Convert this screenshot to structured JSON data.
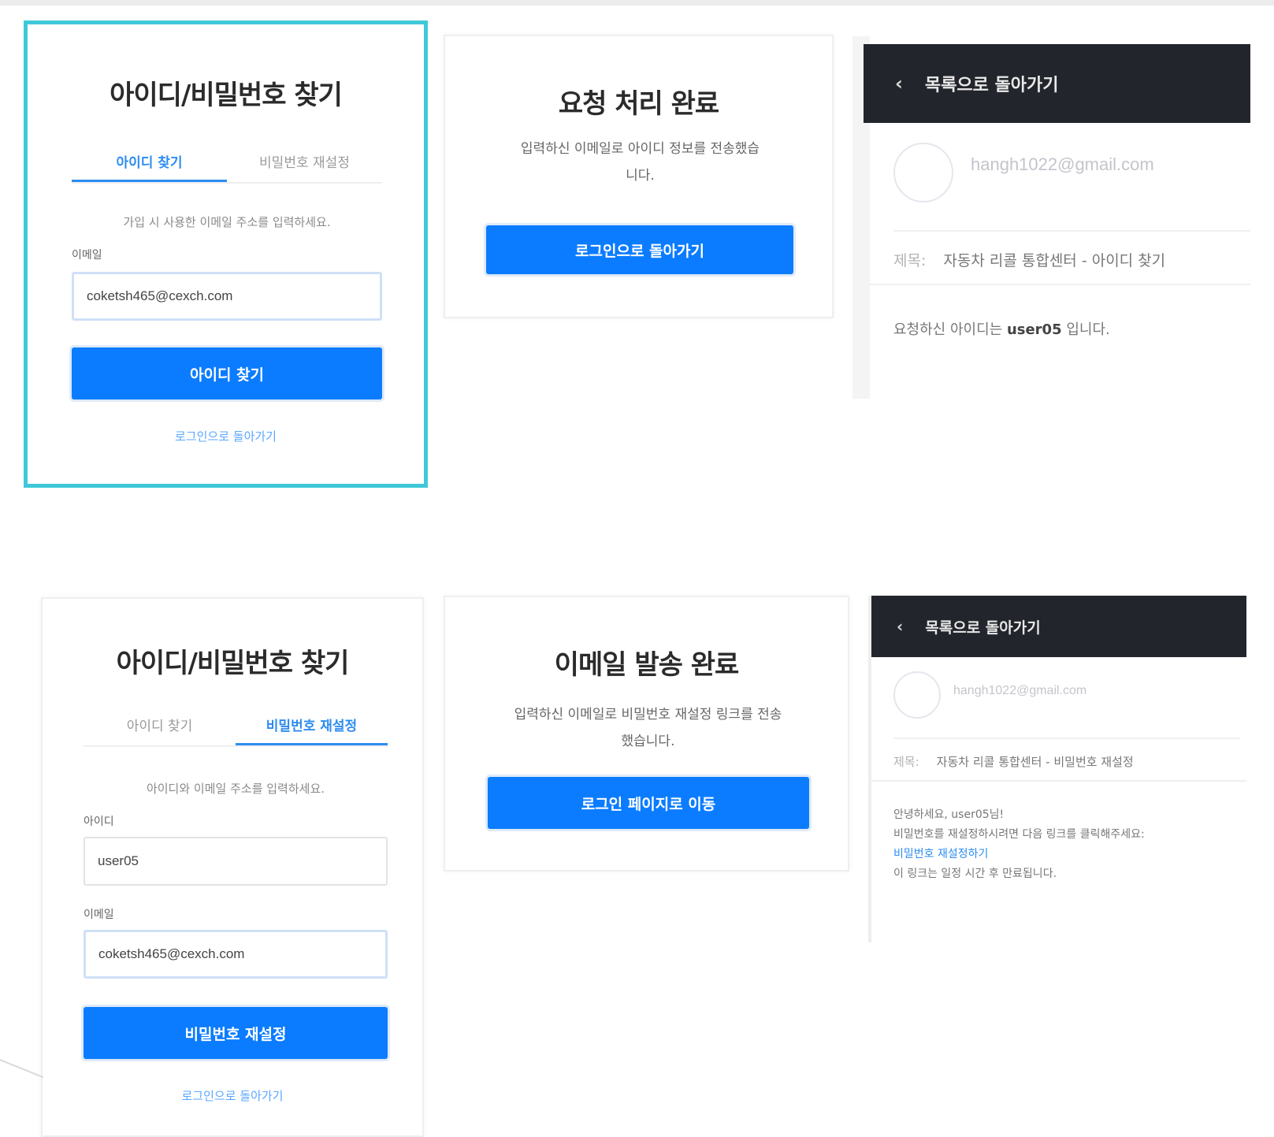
{
  "find_id": {
    "title": "아이디/비밀번호 찾기",
    "tabs": [
      "아이디 찾기",
      "비밀번호 재설정"
    ],
    "active_tab": 0,
    "description": "가입 시 사용한 이메일 주소를 입력하세요.",
    "email_label": "이메일",
    "email_value": "coketsh465@cexch.com",
    "submit_label": "아이디 찾기",
    "back_link": "로그인으로 돌아가기"
  },
  "request_done": {
    "title": "요청 처리 완료",
    "message_line1": "입력하신 이메일로 아이디 정보를 전송했습",
    "message_line2": "니다.",
    "button_label": "로그인으로 돌아가기"
  },
  "mail_id": {
    "back_label": "목록으로 돌아가기",
    "sender": "hangh1022@gmail.com",
    "subject_key": "제목:",
    "subject": "자동차 리콜 통합센터 - 아이디 찾기",
    "body_prefix": "요청하신 아이디는 ",
    "body_user": "user05",
    "body_suffix": " 입니다."
  },
  "reset_pw": {
    "title": "아이디/비밀번호 찾기",
    "tabs": [
      "아이디 찾기",
      "비밀번호 재설정"
    ],
    "active_tab": 1,
    "description": "아이디와 이메일 주소를 입력하세요.",
    "id_label": "아이디",
    "id_value": "user05",
    "email_label": "이메일",
    "email_value": "coketsh465@cexch.com",
    "submit_label": "비밀번호 재설정",
    "back_link": "로그인으로 돌아가기"
  },
  "email_sent": {
    "title": "이메일 발송 완료",
    "message_line1": "입력하신 이메일로 비밀번호 재설정 링크를 전송",
    "message_line2": "했습니다.",
    "button_label": "로그인 페이지로 이동"
  },
  "mail_pw": {
    "back_label": "목록으로 돌아가기",
    "sender": "hangh1022@gmail.com",
    "subject_key": "제목:",
    "subject": "자동차 리콜 통합센터 - 비밀번호 재설정",
    "greeting": "안녕하세요, user05님!",
    "instruction": "비밀번호를 재설정하시려면 다음 링크를 클릭해주세요:",
    "link_text": "비밀번호 재설정하기",
    "expiry": "이 링크는 일정 시간 후 만료됩니다."
  },
  "colors": {
    "primary": "#0b7cff",
    "highlight_border": "#3fc8d8",
    "mail_header": "#23252c"
  }
}
